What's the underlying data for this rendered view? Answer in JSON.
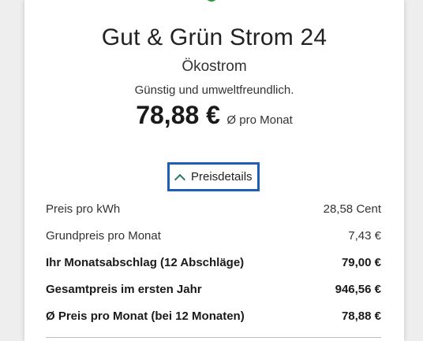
{
  "tariff": {
    "name": "Gut & Grün Strom 24",
    "type": "Ökostrom",
    "tagline": "Günstig und umweltfreundlich.",
    "price": "78,88 €",
    "price_unit": "Ø pro Monat"
  },
  "details_toggle": {
    "label": "Preisdetails",
    "expanded": true
  },
  "price_details": [
    {
      "label": "Preis pro kWh",
      "value": "28,58 Cent",
      "bold": false
    },
    {
      "label": "Grundpreis pro Monat",
      "value": "7,43 €",
      "bold": false
    },
    {
      "label": "Ihr Monatsabschlag (12 Abschläge)",
      "value": "79,00 €",
      "bold": true
    },
    {
      "label": "Gesamtpreis im ersten Jahr",
      "value": "946,56 €",
      "bold": true
    },
    {
      "label": "Ø Preis pro Monat (bei 12 Monaten)",
      "value": "78,88 €",
      "bold": true
    }
  ],
  "colors": {
    "accent_focus": "#1d5fb8",
    "eco_green": "#2a9a3a"
  }
}
